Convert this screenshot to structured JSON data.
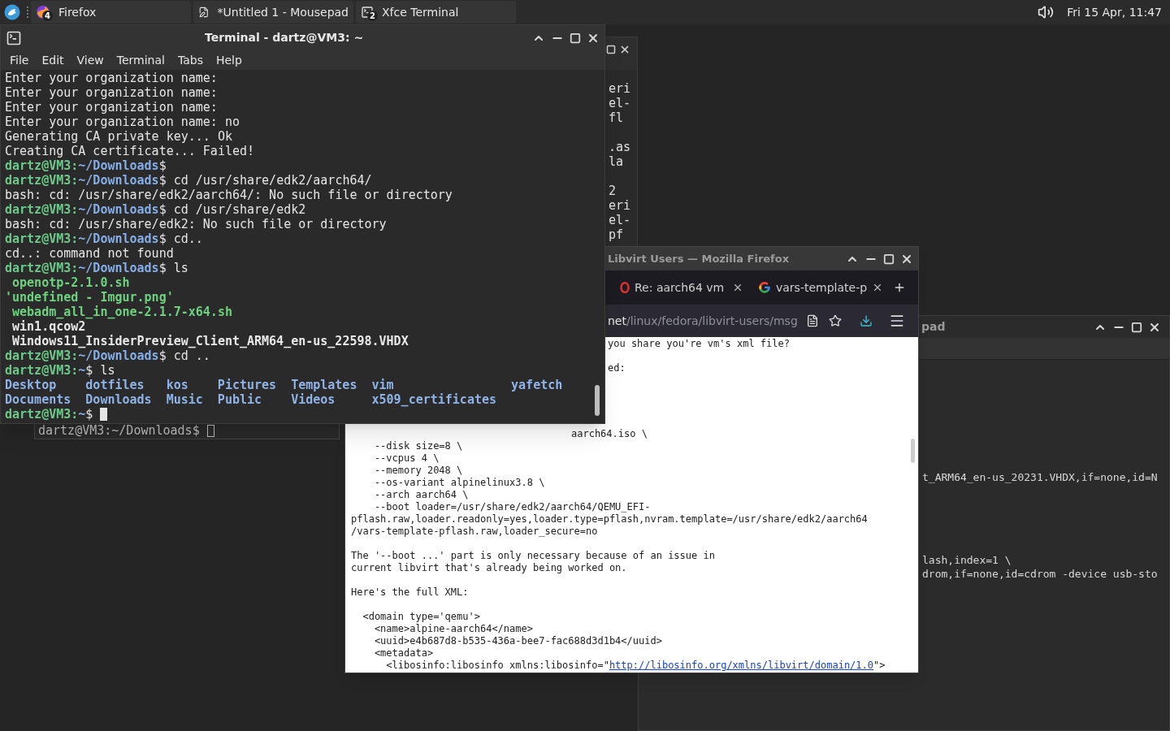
{
  "panel": {
    "tasks": [
      {
        "kind": "browser",
        "label": "Firefox",
        "badge": "4"
      },
      {
        "kind": "editor",
        "label": "*Untitled 1 - Mousepad"
      },
      {
        "kind": "terminal",
        "label": "Xfce Terminal",
        "badge": "2"
      }
    ],
    "clock": "Fri 15 Apr, 11:47"
  },
  "back_terminal": {
    "line_groups": [
      [
        "eri",
        "el-",
        "fl"
      ],
      [
        ".as",
        "la"
      ],
      [
        "2",
        "eri",
        "el-",
        "pf"
      ]
    ]
  },
  "lower_terminal": {
    "prompt": "dartz@VM3:~/Downloads$"
  },
  "mousepad": {
    "title": "pad",
    "line_groups": [
      [
        "t_ARM64_en-us_20231.VHDX,if=none,id=N"
      ],
      [
        "lash,index=1 \\",
        "drom,if=none,id=cdrom -device usb-sto"
      ]
    ]
  },
  "firefox": {
    "title": "Libvirt Users — Mozilla Firefox",
    "tabs": [
      {
        "kind": "ring",
        "label": "Re: aarch64 vm",
        "selected": false
      },
      {
        "kind": "g",
        "label": "vars-template-p",
        "selected": false
      }
    ],
    "url": {
      "host": "net",
      "path": "/linux/fedora/libvirt-users/msg"
    },
    "clipped_lines": [
      "you share you're vm's xml file?",
      "ed:",
      "aarch64.iso \\"
    ],
    "paragraphs": [
      [
        "    --disk size=8 \\",
        "    --vcpus 4 \\",
        "    --memory 2048 \\",
        "    --os-variant alpinelinux3.8 \\",
        "    --arch aarch64 \\",
        "    --boot loader=/usr/share/edk2/aarch64/QEMU_EFI-",
        "pflash.raw,loader.readonly=yes,loader.type=pflash,nvram.template=/usr/share/edk2/aarch64",
        "/vars-template-pflash.raw,loader_secure=no"
      ],
      [
        "The '--boot ...' part is only necessary because of an issue in",
        "current libvirt that's already being worked on."
      ],
      [
        "Here's the full XML:"
      ],
      [
        "  <domain type='qemu'>",
        "    <name>alpine-aarch64</name>",
        "    <uuid>e4b687d8-b535-436a-bee7-fac688d3d1b4</uuid>",
        "    <metadata>"
      ]
    ],
    "last_line": {
      "before": "      <libosinfo:libosinfo xmlns:libosinfo=\"",
      "link": "http://libosinfo.org/xmlns/libvirt/domain/1.0",
      "after": "\">"
    }
  },
  "terminal": {
    "title": "Terminal - dartz@VM3: ~",
    "menu": [
      "File",
      "Edit",
      "View",
      "Terminal",
      "Tabs",
      "Help"
    ],
    "lines": [
      {
        "kind": "text",
        "text": "Enter your organization name:"
      },
      {
        "kind": "text",
        "text": "Enter your organization name:"
      },
      {
        "kind": "text",
        "text": "Enter your organization name:"
      },
      {
        "kind": "text",
        "text": "Enter your organization name: no"
      },
      {
        "kind": "text",
        "text": "Generating CA private key... Ok"
      },
      {
        "kind": "text",
        "text": "Creating CA certificate... Failed!"
      },
      {
        "kind": "prompt",
        "host": "dartz@VM3",
        "sep": ":",
        "path": "~/Downloads",
        "tail": "$",
        "cursor": false
      },
      {
        "kind": "prompt",
        "host": "dartz@VM3",
        "sep": ":",
        "path": "~/Downloads",
        "tail": "$ cd /usr/share/edk2/aarch64/",
        "cursor": false
      },
      {
        "kind": "text",
        "text": "bash: cd: /usr/share/edk2/aarch64/: No such file or directory"
      },
      {
        "kind": "prompt",
        "host": "dartz@VM3",
        "sep": ":",
        "path": "~/Downloads",
        "tail": "$ cd /usr/share/edk2",
        "cursor": false
      },
      {
        "kind": "text",
        "text": "bash: cd: /usr/share/edk2: No such file or directory"
      },
      {
        "kind": "prompt",
        "host": "dartz@VM3",
        "sep": ":",
        "path": "~/Downloads",
        "tail": "$ cd..",
        "cursor": false
      },
      {
        "kind": "text",
        "text": "cd..: command not found"
      },
      {
        "kind": "prompt",
        "host": "dartz@VM3",
        "sep": ":",
        "path": "~/Downloads",
        "tail": "$ ls",
        "cursor": false
      },
      {
        "kind": "file",
        "text": "openotp-2.1.0.sh",
        "color": "#6dd17f"
      },
      {
        "kind": "quoted_file",
        "text": "'undefined - Imgur.png'",
        "color": "#6dd17f"
      },
      {
        "kind": "file",
        "text": "webadm_all_in_one-2.1.7-x64.sh",
        "color": "#6dd17f"
      },
      {
        "kind": "file",
        "text": "win1.qcow2",
        "color": "#e8e8e8"
      },
      {
        "kind": "file",
        "text": "Windows11_InsiderPreview_Client_ARM64_en-us_22598.VHDX",
        "color": "#e8e8e8"
      },
      {
        "kind": "prompt",
        "host": "dartz@VM3",
        "sep": ":",
        "path": "~/Downloads",
        "tail": "$ cd ..",
        "cursor": false
      },
      {
        "kind": "prompt",
        "host": "dartz@VM3",
        "sep": ":",
        "path": "~",
        "tail": "$ ls",
        "cursor": false
      },
      {
        "kind": "columns",
        "rows": [
          [
            "Desktop",
            "dotfiles",
            "kos",
            "Pictures",
            "Templates",
            "vim",
            "yafetch"
          ],
          [
            "Documents",
            "Downloads",
            "Music",
            "Public",
            "Videos",
            "x509_certificates"
          ]
        ]
      },
      {
        "kind": "prompt",
        "host": "dartz@VM3",
        "sep": ":",
        "path": "~",
        "tail": "$",
        "cursor": true
      }
    ]
  }
}
